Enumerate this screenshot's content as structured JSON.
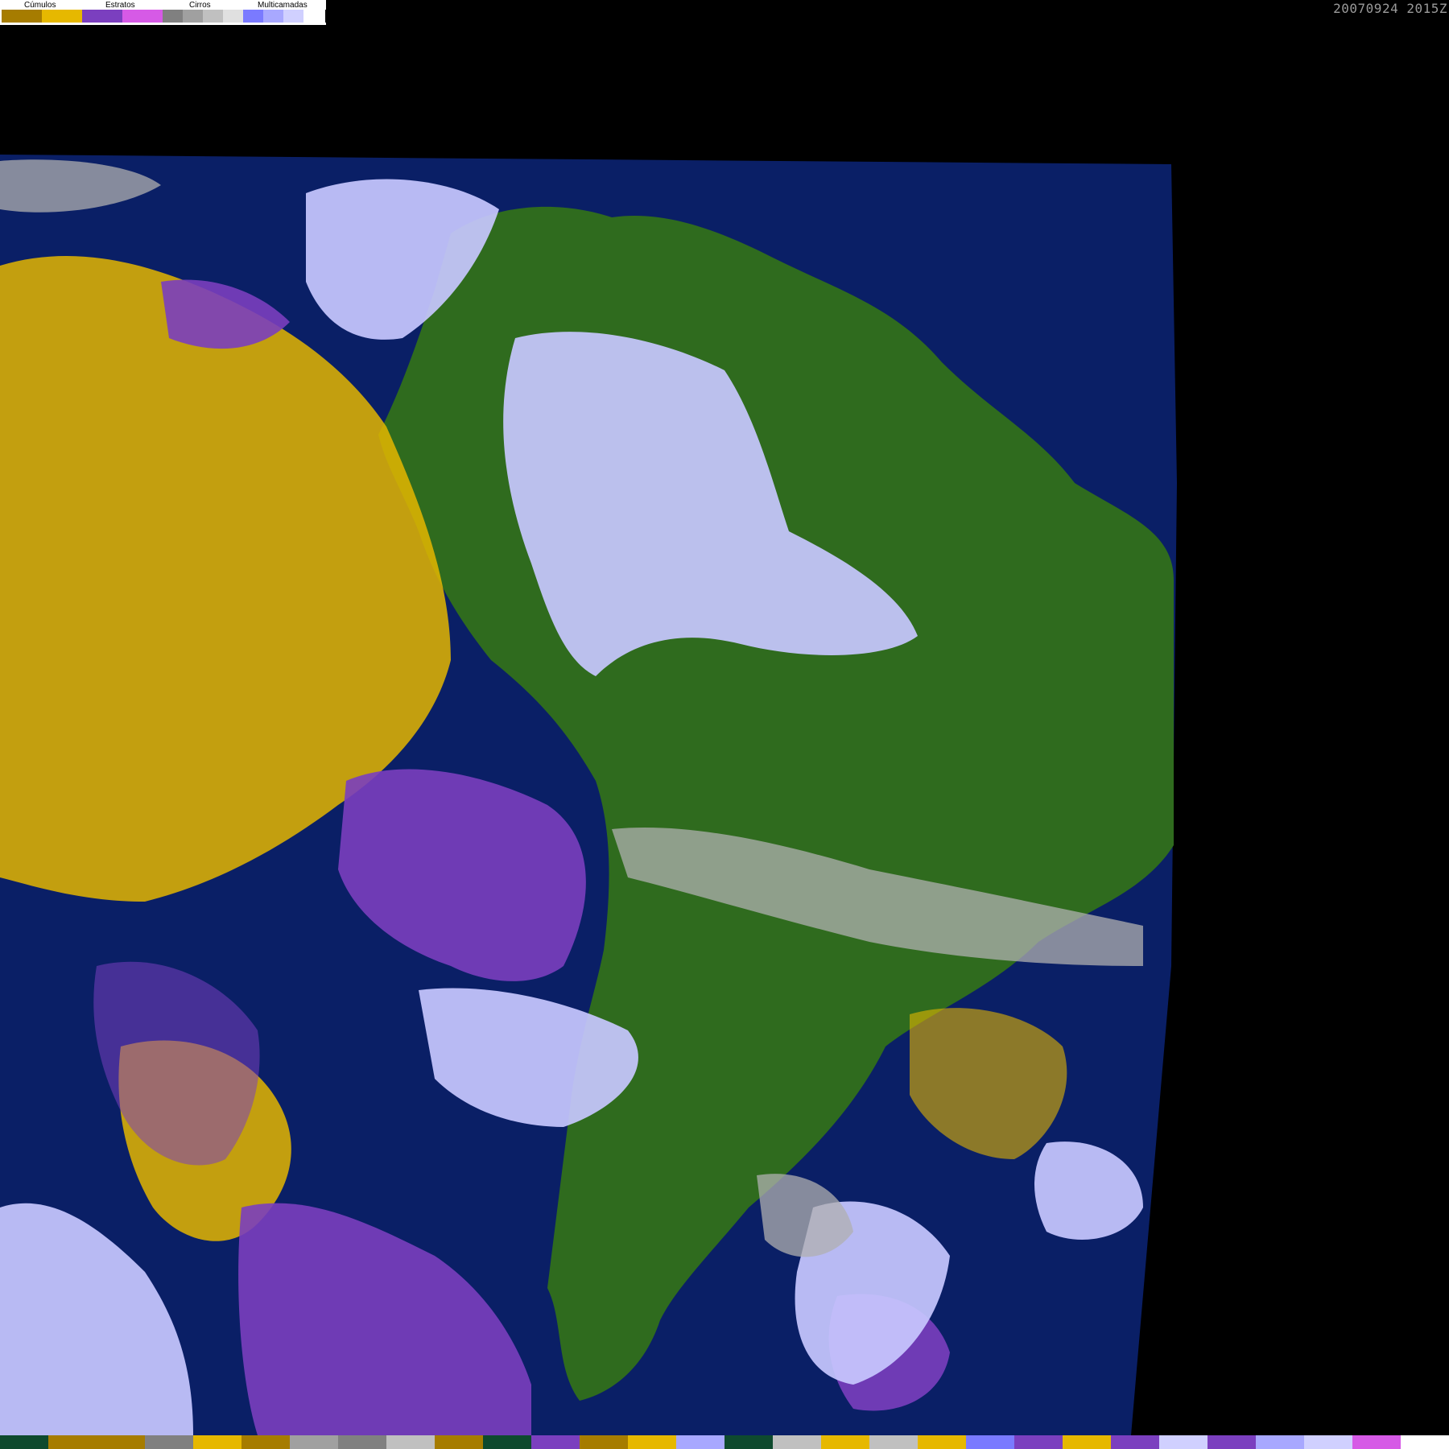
{
  "legend": {
    "cumulos_label": "Cúmulos",
    "estratos_label": "Estratos",
    "cirros_label": "Cirros",
    "multicamadas_label": "Multicamadas",
    "swatches": [
      {
        "group": "cumulos",
        "color": "#A67C00"
      },
      {
        "group": "cumulos",
        "color": "#E6B800"
      },
      {
        "group": "estratos",
        "color": "#7B3FBF"
      },
      {
        "group": "estratos",
        "color": "#D65AE6"
      },
      {
        "group": "cirros",
        "color": "#808080"
      },
      {
        "group": "cirros",
        "color": "#A0A0A0"
      },
      {
        "group": "cirros",
        "color": "#C0C0C0"
      },
      {
        "group": "cirros",
        "color": "#E0E0E0"
      },
      {
        "group": "multicamadas",
        "color": "#7A7AFF"
      },
      {
        "group": "multicamadas",
        "color": "#A8A8FF"
      },
      {
        "group": "multicamadas",
        "color": "#D0D0FF"
      },
      {
        "group": "multicamadas",
        "color": "#FFFFFF"
      }
    ]
  },
  "timestamp": "20070924 2015Z",
  "map_colors": {
    "space": "#000000",
    "ocean": "#0A1F66",
    "land": "#2F6B1E",
    "cumulos": "#E6B800",
    "estratos": "#7B3FBF",
    "cirros": "#B0B0B0",
    "multicamadas": "#C8C8FF"
  },
  "bottom_strip": [
    "#0E4A2E",
    "#A67C00",
    "#A67C00",
    "#808080",
    "#E6B800",
    "#A67C00",
    "#A0A0A0",
    "#808080",
    "#C0C0C0",
    "#A67C00",
    "#0E4A2E",
    "#7B3FBF",
    "#A67C00",
    "#E6B800",
    "#A8A8FF",
    "#0E4A2E",
    "#C0C0C0",
    "#E6B800",
    "#C0C0C0",
    "#E6B800",
    "#7A7AFF",
    "#7B3FBF",
    "#E6B800",
    "#7B3FBF",
    "#D0D0FF",
    "#7B3FBF",
    "#A8A8FF",
    "#D0D0FF",
    "#D65AE6",
    "#FFFFFF"
  ]
}
